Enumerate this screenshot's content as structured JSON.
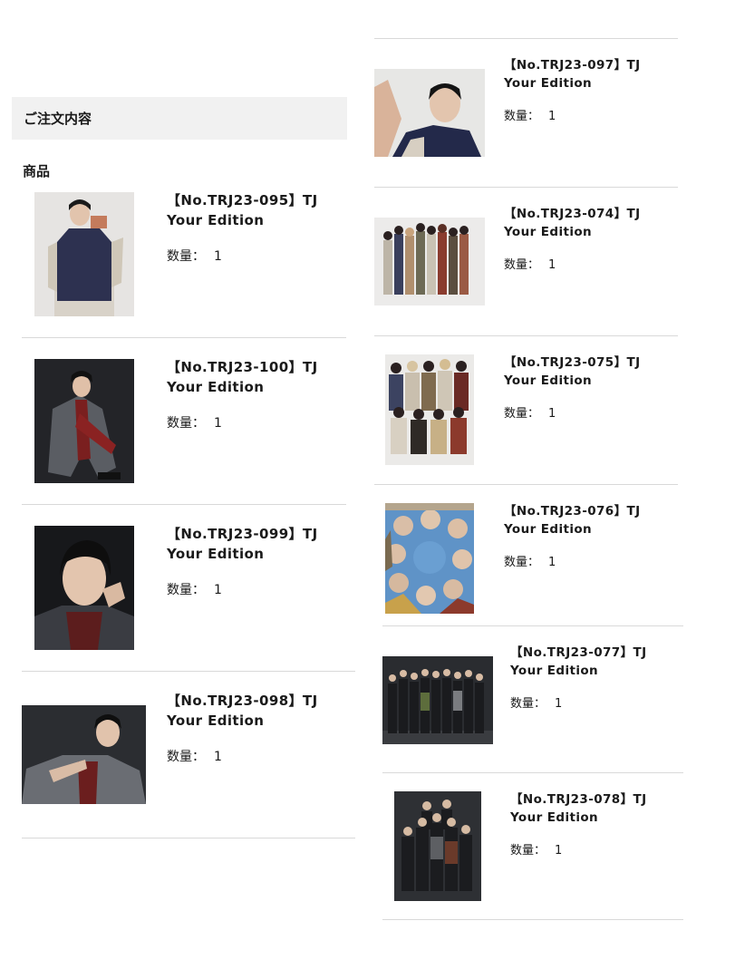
{
  "order": {
    "header": "ご注文内容",
    "section_label": "商品"
  },
  "quantity_label": "数量：",
  "left_items": [
    {
      "title_line1": "【No.TRJ23-095】TJ",
      "title_line2": "Your Edition",
      "quantity": "1",
      "photo_desc": "solo-vest"
    },
    {
      "title_line1": "【No.TRJ23-100】TJ",
      "title_line2": "Your Edition",
      "quantity": "1",
      "photo_desc": "solo-seated"
    },
    {
      "title_line1": "【No.TRJ23-099】TJ",
      "title_line2": "Your Edition",
      "quantity": "1",
      "photo_desc": "solo-closeup"
    },
    {
      "title_line1": "【No.TRJ23-098】TJ",
      "title_line2": "Your Edition",
      "quantity": "1",
      "photo_desc": "solo-landscape"
    }
  ],
  "right_items": [
    {
      "title_line1": "【No.TRJ23-097】TJ",
      "title_line2": "Your Edition",
      "quantity": "1",
      "photo_desc": "solo-selfie"
    },
    {
      "title_line1": "【No.TRJ23-074】TJ",
      "title_line2": "Your Edition",
      "quantity": "1",
      "photo_desc": "group-white"
    },
    {
      "title_line1": "【No.TRJ23-075】TJ",
      "title_line2": "Your Edition",
      "quantity": "1",
      "photo_desc": "group-two-rows"
    },
    {
      "title_line1": "【No.TRJ23-076】TJ",
      "title_line2": "Your Edition",
      "quantity": "1",
      "photo_desc": "group-sky-circle"
    },
    {
      "title_line1": "【No.TRJ23-077】TJ",
      "title_line2": "Your Edition",
      "quantity": "1",
      "photo_desc": "group-dark-wide"
    },
    {
      "title_line1": "【No.TRJ23-078】TJ",
      "title_line2": "Your Edition",
      "quantity": "1",
      "photo_desc": "group-dark-tall"
    }
  ]
}
